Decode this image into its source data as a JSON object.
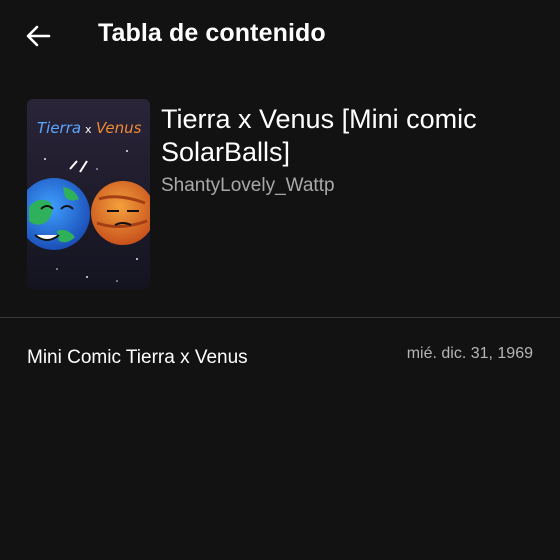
{
  "header": {
    "back_icon": "arrow-left-icon",
    "title": "Tabla de contenido"
  },
  "story": {
    "title": "Tierra x Venus [Mini comic SolarBalls]",
    "author": "ShantyLovely_Wattp",
    "cover": {
      "text_tierra": "Tierra",
      "text_x": "x",
      "text_venus": "Venus"
    }
  },
  "chapters": [
    {
      "title": "Mini Comic Tierra x Venus",
      "date": "mié. dic. 31, 1969"
    }
  ],
  "colors": {
    "background": "#121212",
    "text_primary": "#ffffff",
    "text_secondary": "#a9a9a9",
    "divider": "#3a3a3a"
  }
}
